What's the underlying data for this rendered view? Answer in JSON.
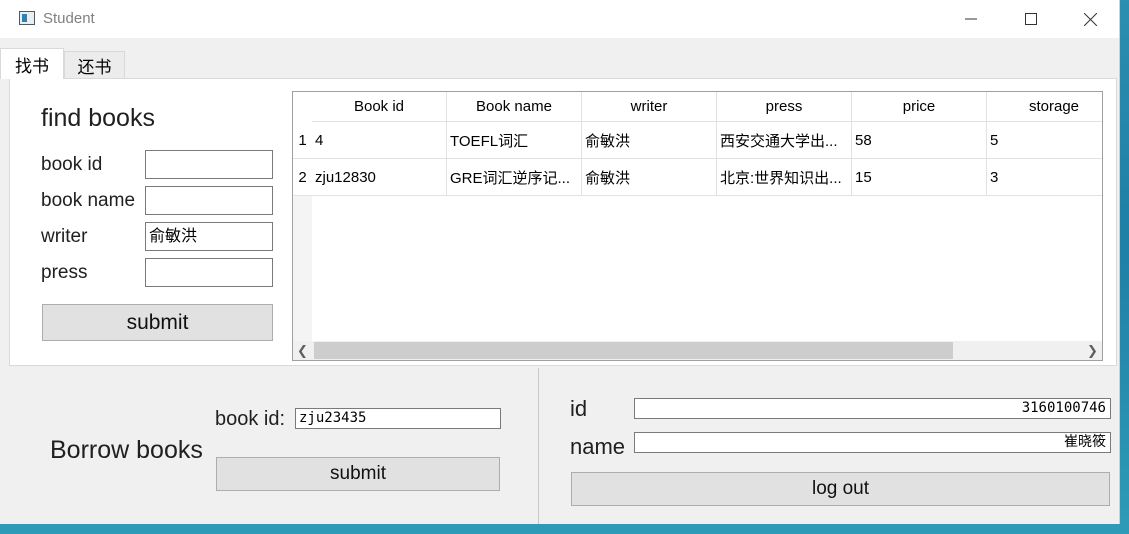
{
  "window": {
    "title": "Student"
  },
  "tabs": [
    {
      "label": "找书"
    },
    {
      "label": "还书"
    }
  ],
  "find": {
    "heading": "find books",
    "labels": {
      "book_id": "book id",
      "book_name": "book name",
      "writer": "writer",
      "press": "press"
    },
    "values": {
      "book_id": "",
      "book_name": "",
      "writer": "俞敏洪",
      "press": ""
    },
    "submit_label": "submit"
  },
  "table": {
    "columns": [
      "Book id",
      "Book name",
      "writer",
      "press",
      "price",
      "storage"
    ],
    "rows": [
      {
        "num": "1",
        "cells": [
          "4",
          "TOEFL词汇",
          "俞敏洪",
          "西安交通大学出...",
          "58",
          "5"
        ]
      },
      {
        "num": "2",
        "cells": [
          "zju12830",
          "GRE词汇逆序记...",
          "俞敏洪",
          "北京:世界知识出...",
          "15",
          "3"
        ]
      }
    ]
  },
  "borrow": {
    "heading": "Borrow books",
    "book_id_label": "book id:",
    "book_id_value": "zju23435",
    "submit_label": "submit"
  },
  "user": {
    "id_label": "id",
    "id_value": "3160100746",
    "name_label": "name",
    "name_value": "崔晓筱",
    "logout_label": "log out"
  }
}
